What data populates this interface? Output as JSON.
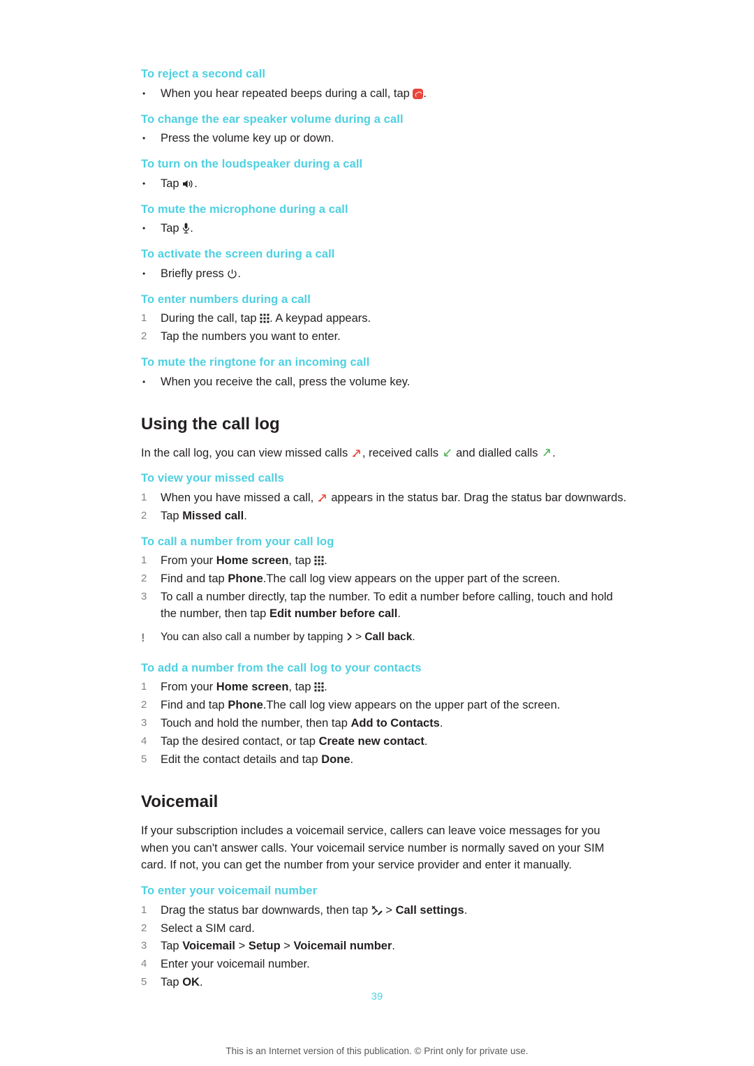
{
  "page": {
    "number": "39",
    "footer": "This is an Internet version of this publication. © Print only for private use."
  },
  "blocks": [
    {
      "heading": "To reject a second call",
      "items": [
        {
          "marker": "•",
          "text_pre": "When you hear repeated beeps during a call, tap ",
          "icon": "reject-call-icon",
          "text_post": "."
        }
      ]
    },
    {
      "heading": "To change the ear speaker volume during a call",
      "items": [
        {
          "marker": "•",
          "text_pre": "Press the volume key up or down.",
          "icon": "",
          "text_post": ""
        }
      ]
    },
    {
      "heading": "To turn on the loudspeaker during a call",
      "items": [
        {
          "marker": "•",
          "text_pre": "Tap ",
          "icon": "loudspeaker-icon",
          "text_post": "."
        }
      ]
    },
    {
      "heading": "To mute the microphone during a call",
      "items": [
        {
          "marker": "•",
          "text_pre": "Tap ",
          "icon": "microphone-icon",
          "text_post": "."
        }
      ]
    },
    {
      "heading": "To activate the screen during a call",
      "items": [
        {
          "marker": "•",
          "text_pre": "Briefly press ",
          "icon": "power-icon",
          "text_post": "."
        }
      ]
    },
    {
      "heading": "To enter numbers during a call",
      "items": [
        {
          "marker": "1",
          "text_pre": "During the call, tap ",
          "icon": "keypad-icon",
          "text_post": ". A keypad appears."
        },
        {
          "marker": "2",
          "text_pre": "Tap the numbers you want to enter.",
          "icon": "",
          "text_post": ""
        }
      ]
    },
    {
      "heading": "To mute the ringtone for an incoming call",
      "items": [
        {
          "marker": "•",
          "text_pre": "When you receive the call, press the volume key.",
          "icon": "",
          "text_post": ""
        }
      ]
    }
  ],
  "call_log": {
    "title": "Using the call log",
    "intro_1": "In the call log, you can view missed calls ",
    "intro_2": ", received calls ",
    "intro_3": " and dialled calls ",
    "intro_4": ".",
    "icons": {
      "missed": "missed-call-arrow-icon",
      "received": "received-call-arrow-icon",
      "dialled": "dialled-call-arrow-icon"
    },
    "sections": [
      {
        "heading": "To view your missed calls",
        "items": [
          {
            "marker": "1",
            "html": "When you have missed a call, @ICON_MISSED@ appears in the status bar. Drag the status bar downwards."
          },
          {
            "marker": "2",
            "html": "Tap <b>Missed call</b>."
          }
        ]
      },
      {
        "heading": "To call a number from your call log",
        "items": [
          {
            "marker": "1",
            "html": "From your <b>Home screen</b>, tap @ICON_KEYPAD@."
          },
          {
            "marker": "2",
            "html": "Find and tap <b>Phone</b>.The call log view appears on the upper part of the screen."
          },
          {
            "marker": "3",
            "html": "To call a number directly, tap the number. To edit a number before calling, touch and hold the number, then tap <b>Edit number before call</b>."
          }
        ],
        "tip": {
          "marker": "!",
          "html": "You can also call a number by tapping @ICON_CHEVRON@ &gt; <b>Call back</b>."
        }
      },
      {
        "heading": "To add a number from the call log to your contacts",
        "items": [
          {
            "marker": "1",
            "html": "From your <b>Home screen</b>, tap @ICON_KEYPAD@."
          },
          {
            "marker": "2",
            "html": "Find and tap <b>Phone</b>.The call log view appears on the upper part of the screen."
          },
          {
            "marker": "3",
            "html": "Touch and hold the number, then tap <b>Add to Contacts</b>."
          },
          {
            "marker": "4",
            "html": "Tap the desired contact, or tap <b>Create new contact</b>."
          },
          {
            "marker": "5",
            "html": "Edit the contact details and tap <b>Done</b>."
          }
        ]
      }
    ]
  },
  "voicemail": {
    "title": "Voicemail",
    "paragraph": "If your subscription includes a voicemail service, callers can leave voice messages for you when you can't answer calls. Your voicemail service number is normally saved on your SIM card. If not, you can get the number from your service provider and enter it manually.",
    "sections": [
      {
        "heading": "To enter your voicemail number",
        "items": [
          {
            "marker": "1",
            "html": "Drag the status bar downwards, then tap @ICON_WRENCH@ &gt; <b>Call settings</b>."
          },
          {
            "marker": "2",
            "html": "Select a SIM card."
          },
          {
            "marker": "3",
            "html": "Tap <b>Voicemail</b> &gt; <b>Setup</b> &gt; <b>Voicemail number</b>."
          },
          {
            "marker": "4",
            "html": "Enter your voicemail number."
          },
          {
            "marker": "5",
            "html": "Tap <b>OK</b>."
          }
        ]
      }
    ]
  },
  "colors": {
    "heading_accent": "#4dd0e1",
    "body_text": "#231f20",
    "marker_grey": "#808285",
    "reject_red": "#e8453c",
    "missed_red": "#e8453c",
    "received_green": "#4caf50",
    "dialled_green": "#8bc34a"
  }
}
